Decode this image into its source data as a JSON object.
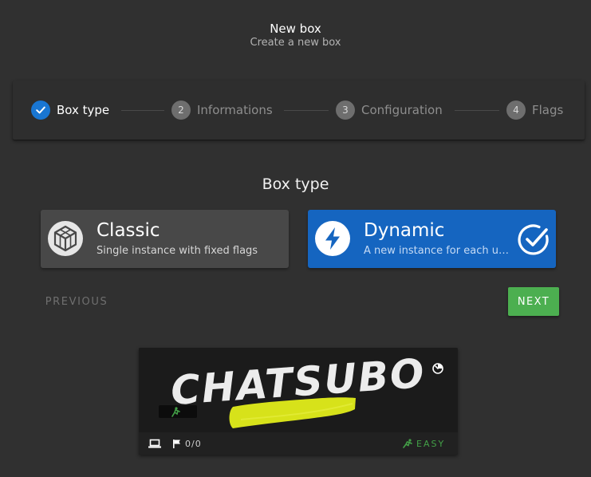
{
  "header": {
    "title": "New box",
    "subtitle": "Create a new box"
  },
  "stepper": {
    "steps": [
      {
        "number": "1",
        "label": "Box type",
        "state": "completed"
      },
      {
        "number": "2",
        "label": "Informations",
        "state": "pending"
      },
      {
        "number": "3",
        "label": "Configuration",
        "state": "pending"
      },
      {
        "number": "4",
        "label": "Flags",
        "state": "pending"
      }
    ]
  },
  "box_type": {
    "section_title": "Box type",
    "options": [
      {
        "title": "Classic",
        "description": "Single instance with fixed flags",
        "icon": "cube-icon",
        "selected": false
      },
      {
        "title": "Dynamic",
        "description": "A new instance for each user",
        "icon": "lightning-bolt-icon",
        "selected": true
      }
    ]
  },
  "actions": {
    "previous_label": "PREVIOUS",
    "next_label": "NEXT"
  },
  "preview_card": {
    "banner_text": "CHATSUBO",
    "flags": "0/0",
    "difficulty": "EASY",
    "icons": [
      "laptop-icon",
      "flag-icon",
      "runner-icon",
      "timer-icon"
    ]
  },
  "colors": {
    "background": "#303030",
    "accent_blue": "#1565c0",
    "step_done": "#1976d2",
    "next_green": "#4caf50",
    "easy_green": "#43a047",
    "banner_yellow": "#d7e21a"
  }
}
